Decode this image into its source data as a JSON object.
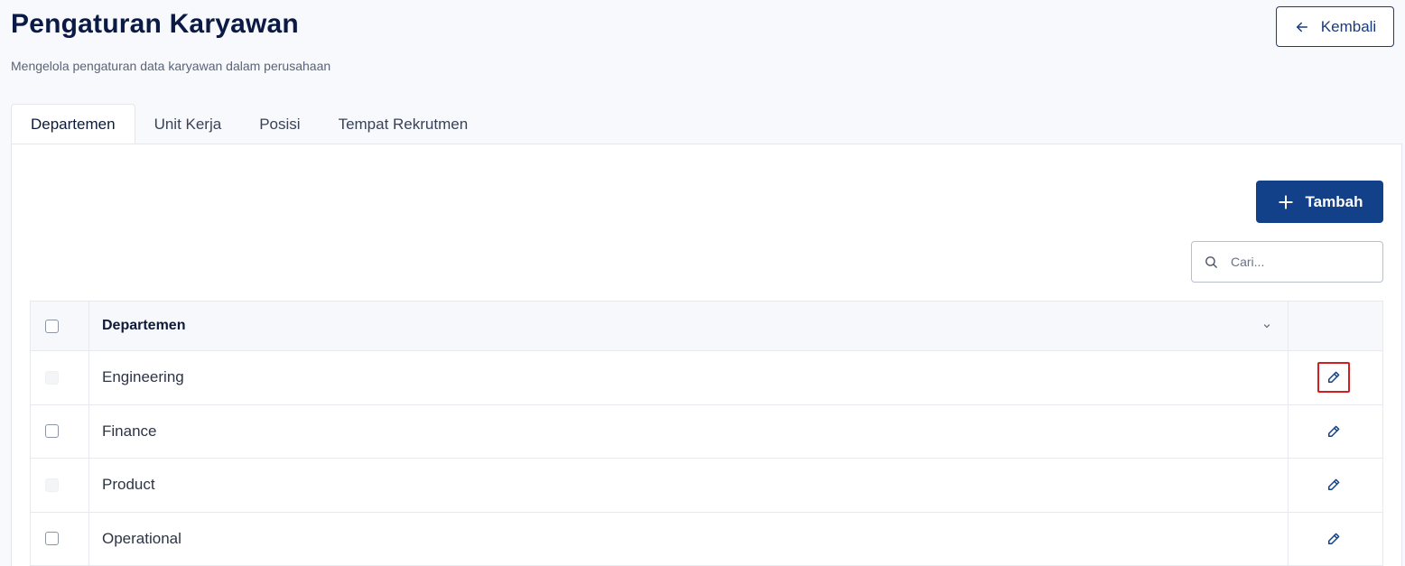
{
  "header": {
    "title": "Pengaturan Karyawan",
    "subtitle": "Mengelola pengaturan data karyawan dalam perusahaan",
    "back_label": "Kembali"
  },
  "tabs": [
    {
      "label": "Departemen",
      "active": true
    },
    {
      "label": "Unit Kerja",
      "active": false
    },
    {
      "label": "Posisi",
      "active": false
    },
    {
      "label": "Tempat Rekrutmen",
      "active": false
    }
  ],
  "toolbar": {
    "add_label": "Tambah",
    "search_placeholder": "Cari..."
  },
  "table": {
    "column_header": "Departemen",
    "rows": [
      {
        "name": "Engineering",
        "checkbox_disabled": true,
        "edit_highlighted": true
      },
      {
        "name": "Finance",
        "checkbox_disabled": false,
        "edit_highlighted": false
      },
      {
        "name": "Product",
        "checkbox_disabled": true,
        "edit_highlighted": false
      },
      {
        "name": "Operational",
        "checkbox_disabled": false,
        "edit_highlighted": false
      }
    ]
  },
  "colors": {
    "primary": "#134189",
    "highlight": "#d21f1f",
    "title": "#0b1a45"
  },
  "icons": {
    "back": "arrow-left-icon",
    "add": "plus-icon",
    "search": "search-icon",
    "sort": "chevron-down-icon",
    "edit": "pencil-icon"
  }
}
